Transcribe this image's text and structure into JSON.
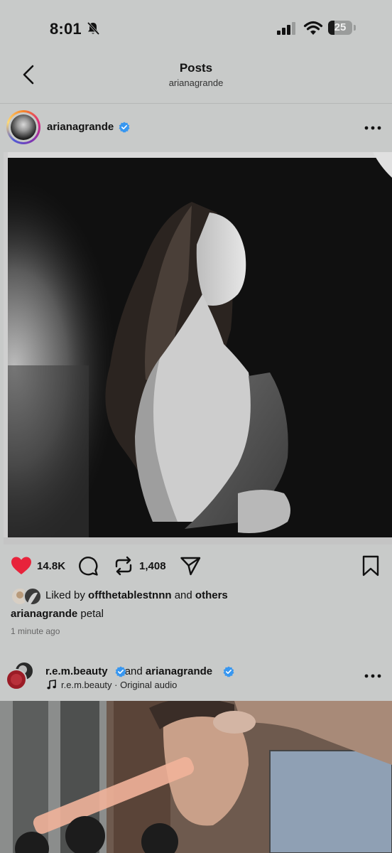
{
  "status_bar": {
    "time": "8:01",
    "battery": "25",
    "battery_level": 0.25
  },
  "header": {
    "title": "Posts",
    "subtitle": "arianagrande"
  },
  "post1": {
    "username": "arianagrande",
    "likes": "14.8K",
    "reposts": "1,408",
    "liked_by_prefix": "Liked by ",
    "liked_by_user": "offthetablestnnn",
    "liked_by_and": " and ",
    "liked_by_others": "others",
    "caption_user": "arianagrande",
    "caption_text": " petal",
    "time_ago": "1 minute ago"
  },
  "post2": {
    "user1": "r.e.m.beauty",
    "and": " and ",
    "user2": "arianagrande",
    "audio": "r.e.m.beauty · Original audio"
  },
  "colors": {
    "heart": "#e8233b",
    "verified": "#3897f0"
  }
}
